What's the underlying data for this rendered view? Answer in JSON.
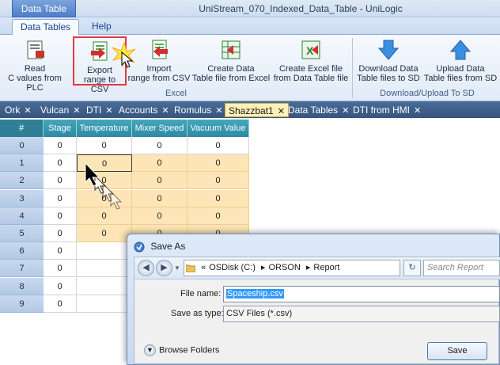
{
  "titlebar": {
    "context_tab": "Data Table",
    "window_title": "UniStream_070_Indexed_Data_Table - UniLogic"
  },
  "ribbon_tabs": [
    "Data Tables",
    "Help"
  ],
  "ribbon": {
    "read": {
      "line1": "Read",
      "line2": "C values from PLC"
    },
    "export": {
      "line1": "Export",
      "line2": "range to CSV"
    },
    "import": {
      "line1": "Import",
      "line2": "range from CSV"
    },
    "create_table": {
      "line1": "Create Data",
      "line2": "Table file from Excel"
    },
    "create_excel": {
      "line1": "Create Excel file",
      "line2": "from Data Table file"
    },
    "download": {
      "line1": "Download Data",
      "line2": "Table files to SD"
    },
    "upload": {
      "line1": "Upload Data",
      "line2": "Table files from SD"
    },
    "group_excel": "Excel",
    "group_sd": "Download/Upload To SD"
  },
  "doc_tabs": [
    "Ork",
    "Vulcan",
    "DTI",
    "Accounts",
    "Romulus",
    "Shazzbat1",
    "Data Tables",
    "DTI from HMI"
  ],
  "doc_tab_close": "✕",
  "grid": {
    "headers": [
      "#",
      "Stage",
      "Temperature",
      "Mixer Speed",
      "Vacuum Value"
    ],
    "rows": [
      [
        "0",
        "0",
        "0",
        "0",
        "0"
      ],
      [
        "1",
        "0",
        "0",
        "0",
        "0"
      ],
      [
        "2",
        "0",
        "0",
        "0",
        "0"
      ],
      [
        "3",
        "0",
        "0",
        "0",
        "0"
      ],
      [
        "4",
        "0",
        "0",
        "0",
        "0"
      ],
      [
        "5",
        "0",
        "0",
        "0",
        "0"
      ],
      [
        "6",
        "0",
        "",
        "",
        ""
      ],
      [
        "7",
        "0",
        "",
        "",
        ""
      ],
      [
        "8",
        "0",
        "",
        "",
        ""
      ],
      [
        "9",
        "0",
        "",
        "",
        ""
      ]
    ]
  },
  "dialog": {
    "title": "Save As",
    "path": {
      "prefix": "«",
      "seg1": "OSDisk (C:)",
      "seg2": "ORSON",
      "seg3": "Report",
      "sep": "▸"
    },
    "search_placeholder": "Search Report",
    "file_name_label": "File name:",
    "file_name_value": "Spaceship.csv",
    "save_type_label": "Save as type:",
    "save_type_value": "CSV Files (*.csv)",
    "browse_folders": "Browse Folders",
    "save_button": "Save"
  },
  "colors": {
    "grid_header": "#2e8aa3",
    "selected_cell": "#fde5b7",
    "highlight_border": "#e0393f"
  }
}
